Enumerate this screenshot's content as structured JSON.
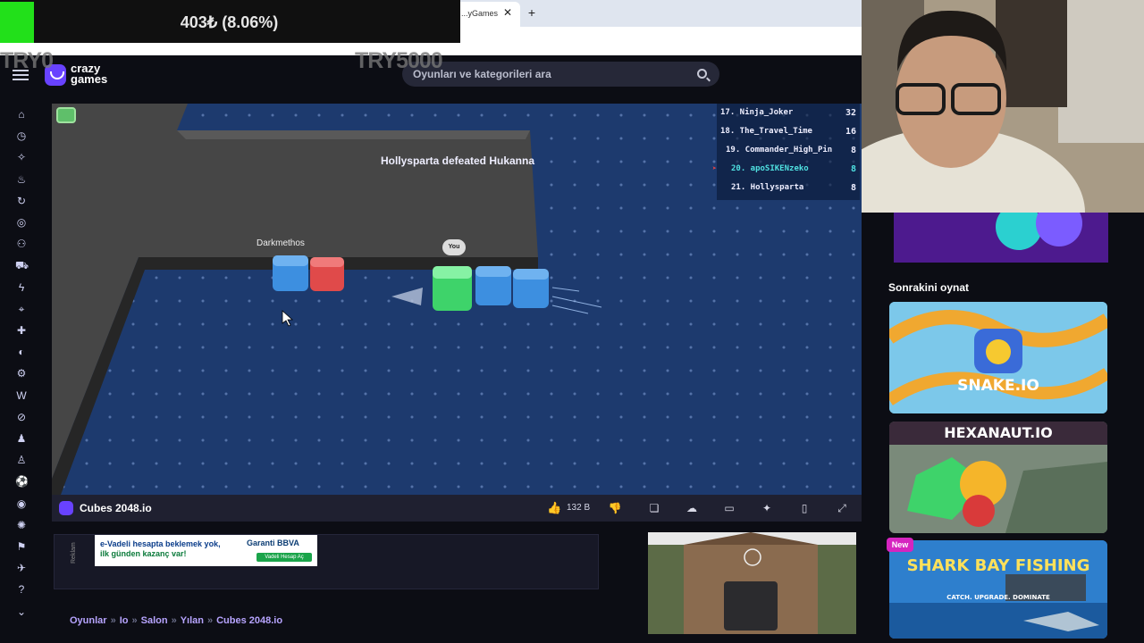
{
  "overlay": {
    "amount": "403₺ (8.06%)",
    "try_left": "TRY0",
    "try_right": "TRY5000"
  },
  "browser": {
    "tab_title": "...yGames"
  },
  "header": {
    "logo_text": "crazy games",
    "search_placeholder": "Oyunları ve kategorileri ara"
  },
  "sidebar": {
    "icons": [
      "home-icon",
      "clock-icon",
      "sparkle-icon",
      "fire-icon",
      "refresh-icon",
      "controller-icon",
      "people-icon",
      "car-icon",
      "lightning-icon",
      "crosshair-icon",
      "puzzle-icon",
      "pacman-icon",
      "gear-icon",
      "word-icon",
      "compass-icon",
      "user-icon",
      "person-icon",
      "soccer-icon",
      "ball-icon",
      "bug-icon",
      "football-icon",
      "pin-icon",
      "help-icon",
      "chevron-icon"
    ]
  },
  "game": {
    "killfeed": "Hollysparta defeated Hukanna",
    "player_names": {
      "darkmethos": "Darkmethos",
      "you": "You"
    },
    "leaderboard": [
      {
        "rank_name": "17. Ninja_Joker",
        "score": "32"
      },
      {
        "rank_name": "18. The_Travel_Time",
        "score": "16"
      },
      {
        "rank_name": "19. Commander_High_Pin",
        "score": "8"
      },
      {
        "rank_name": "20. apoSIKENzeko",
        "score": "8",
        "highlight": true
      },
      {
        "rank_name": "21. Hollysparta",
        "score": "8"
      }
    ],
    "colors": {
      "board": "#1d3a6e",
      "wall": "#4a4a4a",
      "green_cube": "#3ed36a",
      "blue_cube": "#3d8fe0",
      "red_cube": "#e04a4a"
    }
  },
  "gamebar": {
    "title": "Cubes 2048.io",
    "likes": "132 B"
  },
  "ads": {
    "banner_line1": "e-Vadeli hesapta beklemek yok,",
    "banner_line2": "ilk günden kazanç var!",
    "banner_brand": "Garanti BBVA",
    "banner_cta": "Vadeli Hesap Aç",
    "reklam": "Reklam"
  },
  "breadcrumb": [
    "Oyunlar",
    "Io",
    "Salon",
    "Yılan",
    "Cubes 2048.io"
  ],
  "right": {
    "next_title": "Sonrakini oynat",
    "cards": [
      {
        "title": "SNAKE.IO"
      },
      {
        "title": "HEXANAUT.IO"
      },
      {
        "title": "SHARK BAY FISHING",
        "subtitle": "CATCH. UPGRADE. DOMINATE",
        "badge": "New"
      }
    ]
  }
}
